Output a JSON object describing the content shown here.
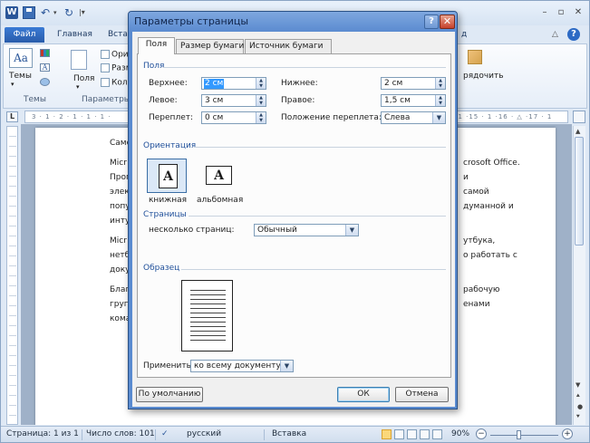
{
  "word": {
    "app_icon_letter": "W",
    "titlebar_controls": {
      "min": "▭",
      "max": "▢",
      "close": "✕"
    },
    "tabs": {
      "file": "Файл",
      "home": "Главная",
      "insert": "Встав",
      "right_fragment": "д"
    },
    "help": "?",
    "ribbon": {
      "themes_label": "Темы",
      "group_themes": "Темы",
      "fields_label": "Поля",
      "group_pagesetup": "Параметры с",
      "pagesetup_items": [
        "Ори",
        "Разм",
        "Кол"
      ],
      "arrange_label": "рядочить"
    },
    "ruler": {
      "corner": "L",
      "left_marks": "3 · 1 · 2 · 1 · 1 · 1 · ",
      "right_marks": "· 1 ·15 · 1 ·16 · △ ·17 · 1"
    },
    "document_lines": {
      "left": [
        "Само",
        "Micr",
        "Прог",
        "элек",
        "попу",
        "инту",
        "Micr",
        "нетб",
        "доку",
        "Благ",
        "груп",
        "кома"
      ],
      "right": [
        "crosoft Office.",
        "и",
        "самой",
        "думанной и",
        "утбука,",
        "о работать с",
        "рабочую",
        "енами"
      ]
    },
    "statusbar": {
      "page": "Страница: 1 из 1",
      "words": "Число слов: 101",
      "language": "русский",
      "mode": "Вставка",
      "zoom": "90%",
      "zoom_out": "−",
      "zoom_in": "+"
    }
  },
  "dialog": {
    "title": "Параметры страницы",
    "help_button": "?",
    "close_button": "✕",
    "tabs": [
      "Поля",
      "Размер бумаги",
      "Источник бумаги"
    ],
    "section_fields": "Поля",
    "fields": {
      "top_label": "Верхнее:",
      "top_value": "2 см",
      "bottom_label": "Нижнее:",
      "bottom_value": "2 см",
      "left_label": "Левое:",
      "left_value": "3 см",
      "right_label": "Правое:",
      "right_value": "1,5 см",
      "gutter_label": "Переплет:",
      "gutter_value": "0 см",
      "gutter_pos_label": "Положение переплета:",
      "gutter_pos_value": "Слева"
    },
    "section_orientation": "Ориентация",
    "orientation": {
      "portrait": "книжная",
      "landscape": "альбомная",
      "selected": "книжная",
      "glyph": "A"
    },
    "section_pages": "Страницы",
    "pages": {
      "multiple_label": "несколько страниц:",
      "multiple_value": "Обычный"
    },
    "section_preview": "Образец",
    "apply": {
      "label": "Применить:",
      "value": "ко всему документу"
    },
    "buttons": {
      "default": "По умолчанию",
      "ok": "ОК",
      "cancel": "Отмена"
    }
  }
}
